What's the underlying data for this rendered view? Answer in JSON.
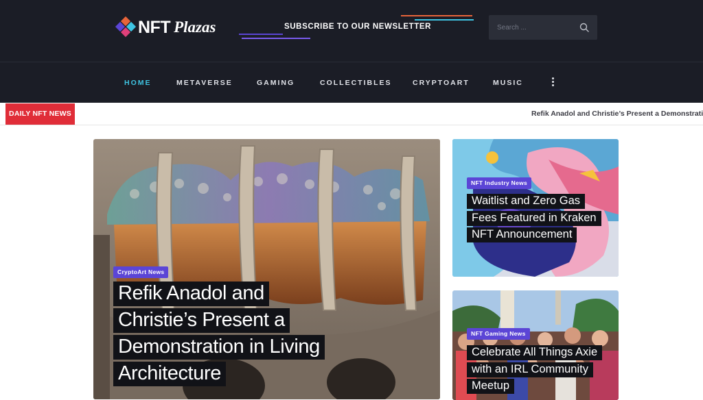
{
  "header": {
    "logo_main": "NFT",
    "logo_script": "Plazas",
    "newsletter_label": "SUBSCRIBE TO OUR NEWSLETTER",
    "search_placeholder": "Search ...",
    "colors": {
      "background": "#1b1d26",
      "accent_orange": "#e8643a",
      "accent_cyan": "#3fc5e3",
      "accent_purple": "#7b5cf0"
    }
  },
  "nav": {
    "items": [
      {
        "label": "HOME",
        "active": true
      },
      {
        "label": "METAVERSE",
        "active": false
      },
      {
        "label": "GAMING",
        "active": false
      },
      {
        "label": "COLLECTIBLES",
        "active": false
      },
      {
        "label": "CRYPTOART",
        "active": false
      },
      {
        "label": "MUSIC",
        "active": false
      }
    ],
    "more_icon": "vertical-ellipsis-icon"
  },
  "ticker": {
    "label": "DAILY NFT NEWS",
    "headline": "Refik Anadol and Christie’s Present a Demonstration"
  },
  "featured": {
    "main": {
      "category": "CryptoArt News",
      "title": "Refik Anadol and Christie’s Present a Demonstration in Living Architecture"
    },
    "side": [
      {
        "category": "NFT Industry News",
        "title": "Waitlist and Zero Gas Fees Featured in Kraken NFT Announcement"
      },
      {
        "category": "NFT Gaming News",
        "title": "Celebrate All Things Axie with an IRL Community Meetup"
      }
    ]
  },
  "colors": {
    "badge": "#5b45d6",
    "ticker_label": "#e02d38",
    "headline_bg": "#111217"
  }
}
